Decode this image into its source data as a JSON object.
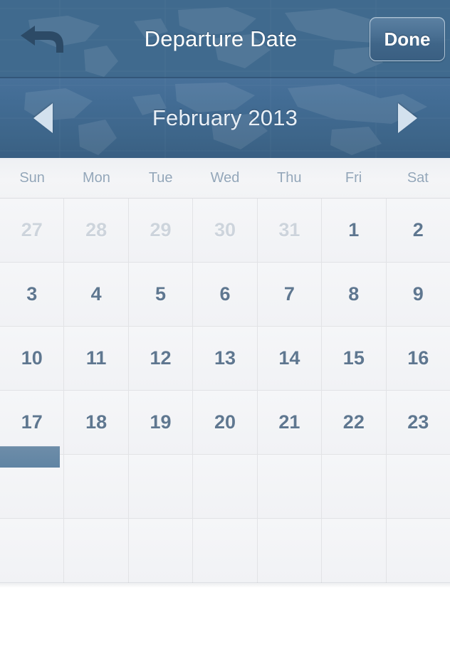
{
  "navbar": {
    "title": "Departure Date",
    "back_icon": "back-arrow-icon",
    "done_label": "Done"
  },
  "monthbar": {
    "label": "February 2013",
    "prev_icon": "triangle-left-icon",
    "next_icon": "triangle-right-icon"
  },
  "calendar": {
    "weekdays": [
      "Sun",
      "Mon",
      "Tue",
      "Wed",
      "Thu",
      "Fri",
      "Sat"
    ],
    "weeks": [
      [
        {
          "label": "27",
          "muted": true
        },
        {
          "label": "28",
          "muted": true
        },
        {
          "label": "29",
          "muted": true
        },
        {
          "label": "30",
          "muted": true
        },
        {
          "label": "31",
          "muted": true
        },
        {
          "label": "1",
          "muted": false
        },
        {
          "label": "2",
          "muted": false
        }
      ],
      [
        {
          "label": "3",
          "muted": false
        },
        {
          "label": "4",
          "muted": false
        },
        {
          "label": "5",
          "muted": false
        },
        {
          "label": "6",
          "muted": false
        },
        {
          "label": "7",
          "muted": false
        },
        {
          "label": "8",
          "muted": false
        },
        {
          "label": "9",
          "muted": false
        }
      ],
      [
        {
          "label": "10",
          "muted": false
        },
        {
          "label": "11",
          "muted": false
        },
        {
          "label": "12",
          "muted": false
        },
        {
          "label": "13",
          "muted": false
        },
        {
          "label": "14",
          "muted": false
        },
        {
          "label": "15",
          "muted": false
        },
        {
          "label": "16",
          "muted": false
        }
      ],
      [
        {
          "label": "17",
          "muted": false
        },
        {
          "label": "18",
          "muted": false
        },
        {
          "label": "19",
          "muted": false
        },
        {
          "label": "20",
          "muted": false
        },
        {
          "label": "21",
          "muted": false
        },
        {
          "label": "22",
          "muted": false
        },
        {
          "label": "23",
          "muted": false
        }
      ],
      [
        {
          "label": "",
          "muted": false,
          "selected": true
        },
        {
          "label": "",
          "muted": false
        },
        {
          "label": "",
          "muted": false
        },
        {
          "label": "",
          "muted": false
        },
        {
          "label": "",
          "muted": false
        },
        {
          "label": "",
          "muted": false
        },
        {
          "label": "",
          "muted": false
        }
      ],
      [
        {
          "label": "",
          "muted": false
        },
        {
          "label": "",
          "muted": false
        },
        {
          "label": "",
          "muted": false
        },
        {
          "label": "",
          "muted": false
        },
        {
          "label": "",
          "muted": false
        },
        {
          "label": "",
          "muted": false
        },
        {
          "label": "",
          "muted": false
        }
      ]
    ]
  },
  "colors": {
    "nav_blue": "#406a8e",
    "month_blue": "#416a90",
    "selection_blue": "#6084a3",
    "day_text": "#5f7790",
    "muted_day_text": "#cdd4dc",
    "weekday_text": "#93a6b9",
    "grid_bg": "#f1f2f5",
    "grid_line": "#e2e3e6"
  }
}
